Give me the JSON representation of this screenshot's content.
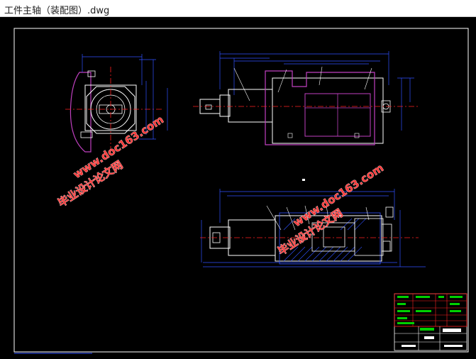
{
  "window": {
    "title": "工件主轴（装配图）.dwg"
  },
  "watermarks": {
    "line1": "毕业设计论文网",
    "line2": "www.doc163.com"
  },
  "colors": {
    "canvas_bg": "#000000",
    "frame": "#ffffff",
    "dimension": "#3050ff",
    "part_outline": "#ffffff",
    "housing": "#c040c0",
    "centerline": "#ff2020",
    "title_block_text": "#00d000",
    "watermark": "#ff3b3b"
  }
}
